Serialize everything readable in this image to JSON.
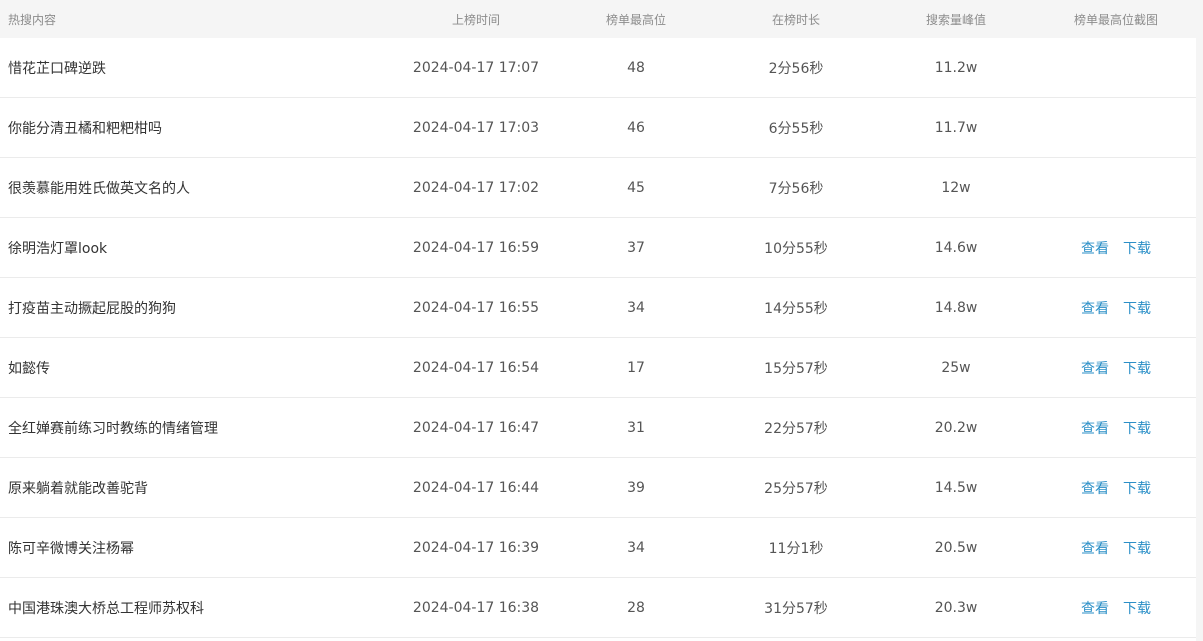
{
  "headers": {
    "title": "热搜内容",
    "time": "上榜时间",
    "rank": "榜单最高位",
    "duration": "在榜时长",
    "peak": "搜索量峰值",
    "screenshot": "榜单最高位截图"
  },
  "link_labels": {
    "view": "查看",
    "download": "下载"
  },
  "rows": [
    {
      "title": "惜花芷口碑逆跌",
      "time": "2024-04-17 17:07",
      "rank": "48",
      "duration": "2分56秒",
      "peak": "11.2w",
      "has_screenshot": false
    },
    {
      "title": "你能分清丑橘和粑粑柑吗",
      "time": "2024-04-17 17:03",
      "rank": "46",
      "duration": "6分55秒",
      "peak": "11.7w",
      "has_screenshot": false
    },
    {
      "title": "很羡慕能用姓氏做英文名的人",
      "time": "2024-04-17 17:02",
      "rank": "45",
      "duration": "7分56秒",
      "peak": "12w",
      "has_screenshot": false
    },
    {
      "title": "徐明浩灯罩look",
      "time": "2024-04-17 16:59",
      "rank": "37",
      "duration": "10分55秒",
      "peak": "14.6w",
      "has_screenshot": true
    },
    {
      "title": "打疫苗主动撅起屁股的狗狗",
      "time": "2024-04-17 16:55",
      "rank": "34",
      "duration": "14分55秒",
      "peak": "14.8w",
      "has_screenshot": true
    },
    {
      "title": "如懿传",
      "time": "2024-04-17 16:54",
      "rank": "17",
      "duration": "15分57秒",
      "peak": "25w",
      "has_screenshot": true
    },
    {
      "title": "全红婵赛前练习时教练的情绪管理",
      "time": "2024-04-17 16:47",
      "rank": "31",
      "duration": "22分57秒",
      "peak": "20.2w",
      "has_screenshot": true
    },
    {
      "title": "原来躺着就能改善驼背",
      "time": "2024-04-17 16:44",
      "rank": "39",
      "duration": "25分57秒",
      "peak": "14.5w",
      "has_screenshot": true
    },
    {
      "title": "陈可辛微博关注杨幂",
      "time": "2024-04-17 16:39",
      "rank": "34",
      "duration": "11分1秒",
      "peak": "20.5w",
      "has_screenshot": true
    },
    {
      "title": "中国港珠澳大桥总工程师苏权科",
      "time": "2024-04-17 16:38",
      "rank": "28",
      "duration": "31分57秒",
      "peak": "20.3w",
      "has_screenshot": true
    }
  ]
}
